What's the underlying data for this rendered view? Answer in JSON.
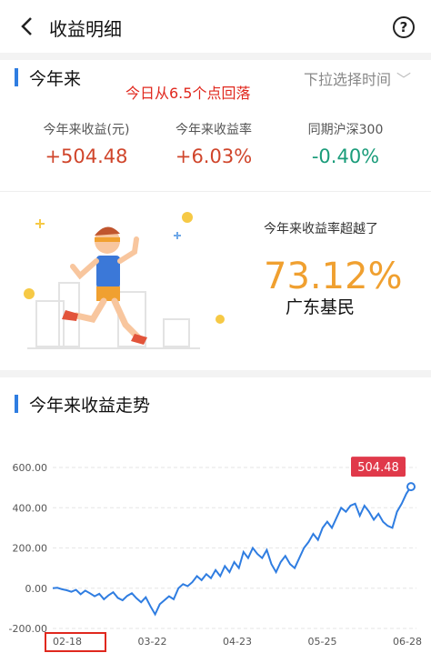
{
  "header": {
    "title": "收益明细",
    "back_icon": "chevron-left-icon",
    "help_icon": "question-circle-icon"
  },
  "summary": {
    "section_title": "今年来",
    "filter_label": "下拉选择时间",
    "annotation": "今日从6.5个点回落",
    "stats": [
      {
        "label": "今年来收益(元)",
        "value": "+504.48"
      },
      {
        "label": "今年来收益率",
        "value": "+6.03%"
      },
      {
        "label": "同期沪深300",
        "value": "-0.40%"
      }
    ]
  },
  "promo": {
    "label": "今年来收益率超越了",
    "percent": "73.12%",
    "group": "广东基民"
  },
  "trend": {
    "section_title": "今年来收益走势"
  },
  "chart_data": {
    "type": "line",
    "y_tick_labels": [
      "600.00",
      "400.00",
      "200.00",
      "0.00",
      "-200.00"
    ],
    "x_tick_labels": [
      "02-18",
      "03-22",
      "04-23",
      "05-25",
      "06-28"
    ],
    "ylim": [
      -200,
      600
    ],
    "grid": true,
    "end_label": "504.48",
    "series": [
      {
        "values": [
          0,
          2,
          -5,
          -10,
          -18,
          -8,
          -30,
          -12,
          -25,
          -40,
          -28,
          -55,
          -35,
          -20,
          -48,
          -60,
          -38,
          -25,
          -50,
          -70,
          -45,
          -90,
          -130,
          -80,
          -60,
          -40,
          -55,
          0,
          20,
          10,
          30,
          60,
          40,
          70,
          50,
          90,
          60,
          110,
          80,
          130,
          100,
          180,
          150,
          200,
          170,
          150,
          190,
          120,
          80,
          130,
          160,
          120,
          100,
          150,
          200,
          230,
          270,
          240,
          300,
          330,
          300,
          350,
          400,
          380,
          410,
          420,
          360,
          410,
          380,
          340,
          370,
          330,
          310,
          300,
          380,
          420,
          470,
          504.48
        ]
      }
    ]
  }
}
